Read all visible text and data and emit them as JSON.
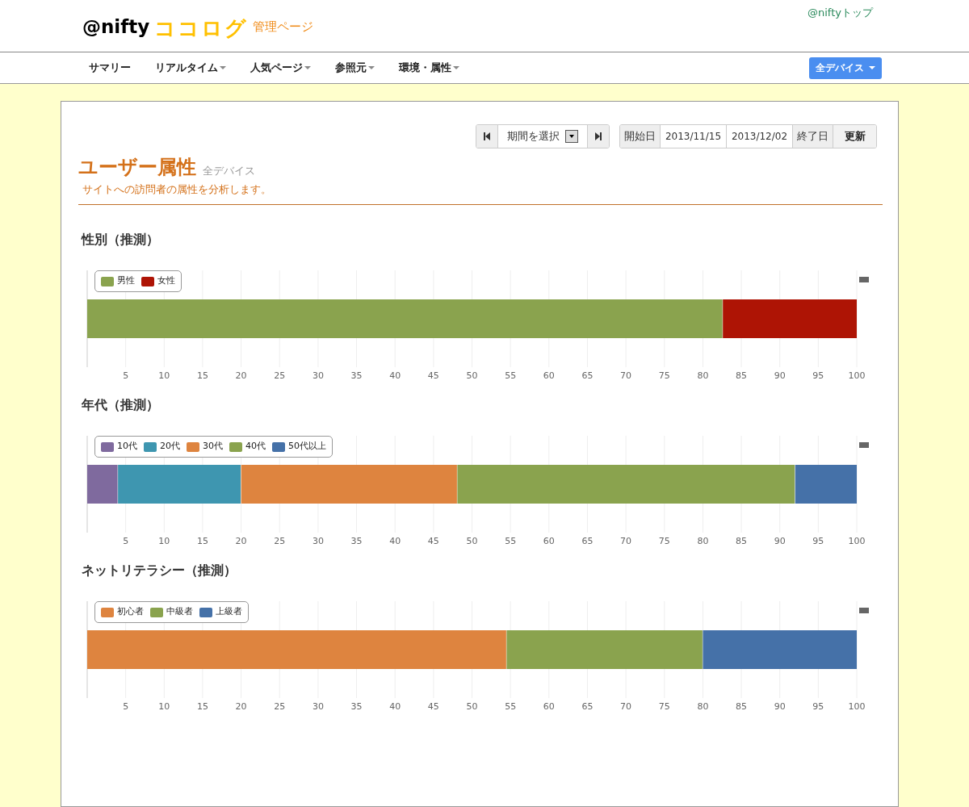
{
  "header": {
    "logo_brand": "@nifty",
    "logo_product": "ココログ",
    "logo_suffix": "管理ページ",
    "top_link": "@niftyトップ"
  },
  "nav": {
    "items": [
      {
        "label": "サマリー",
        "dropdown": false
      },
      {
        "label": "リアルタイム",
        "dropdown": true
      },
      {
        "label": "人気ページ",
        "dropdown": true
      },
      {
        "label": "参照元",
        "dropdown": true
      },
      {
        "label": "環境・属性",
        "dropdown": true
      }
    ],
    "device_button": "全デバイス"
  },
  "toolbar": {
    "period_select": "期間を選択",
    "start_label": "開始日",
    "start_date": "2013/11/15",
    "end_date": "2013/12/02",
    "end_label": "終了日",
    "update_button": "更新"
  },
  "page": {
    "title": "ユーザー属性",
    "subtitle": "全デバイス",
    "description": "サイトへの訪問者の属性を分析します。"
  },
  "sections": [
    {
      "title": "性別（推測）",
      "chart_data": {
        "type": "bar",
        "grid": true,
        "legend": true,
        "orientation": "horizontal",
        "stacked": true,
        "xlim": [
          0,
          100
        ],
        "xticks": [
          5,
          10,
          15,
          20,
          25,
          30,
          35,
          40,
          45,
          50,
          55,
          60,
          65,
          70,
          75,
          80,
          85,
          90,
          95,
          100
        ],
        "series": [
          {
            "name": "男性",
            "color": "#8aa34e",
            "values": [
              82.6
            ]
          },
          {
            "name": "女性",
            "color": "#ae1405",
            "values": [
              17.4
            ]
          }
        ]
      }
    },
    {
      "title": "年代（推測）",
      "chart_data": {
        "type": "bar",
        "grid": true,
        "legend": true,
        "orientation": "horizontal",
        "stacked": true,
        "xlim": [
          0,
          100
        ],
        "xticks": [
          5,
          10,
          15,
          20,
          25,
          30,
          35,
          40,
          45,
          50,
          55,
          60,
          65,
          70,
          75,
          80,
          85,
          90,
          95,
          100
        ],
        "series": [
          {
            "name": "10代",
            "color": "#7f6a9e",
            "values": [
              4.0
            ]
          },
          {
            "name": "20代",
            "color": "#3e96b0",
            "values": [
              16.0
            ]
          },
          {
            "name": "30代",
            "color": "#de843f",
            "values": [
              28.1
            ]
          },
          {
            "name": "40代",
            "color": "#8aa34e",
            "values": [
              43.9
            ]
          },
          {
            "name": "50代以上",
            "color": "#4571a8",
            "values": [
              8.0
            ]
          }
        ]
      }
    },
    {
      "title": "ネットリテラシー（推測）",
      "chart_data": {
        "type": "bar",
        "grid": true,
        "legend": true,
        "orientation": "horizontal",
        "stacked": true,
        "xlim": [
          0,
          100
        ],
        "xticks": [
          5,
          10,
          15,
          20,
          25,
          30,
          35,
          40,
          45,
          50,
          55,
          60,
          65,
          70,
          75,
          80,
          85,
          90,
          95,
          100
        ],
        "series": [
          {
            "name": "初心者",
            "color": "#de843f",
            "values": [
              54.5
            ]
          },
          {
            "name": "中級者",
            "color": "#8aa34e",
            "values": [
              25.5
            ]
          },
          {
            "name": "上級者",
            "color": "#4571a8",
            "values": [
              20.0
            ]
          }
        ]
      }
    }
  ]
}
